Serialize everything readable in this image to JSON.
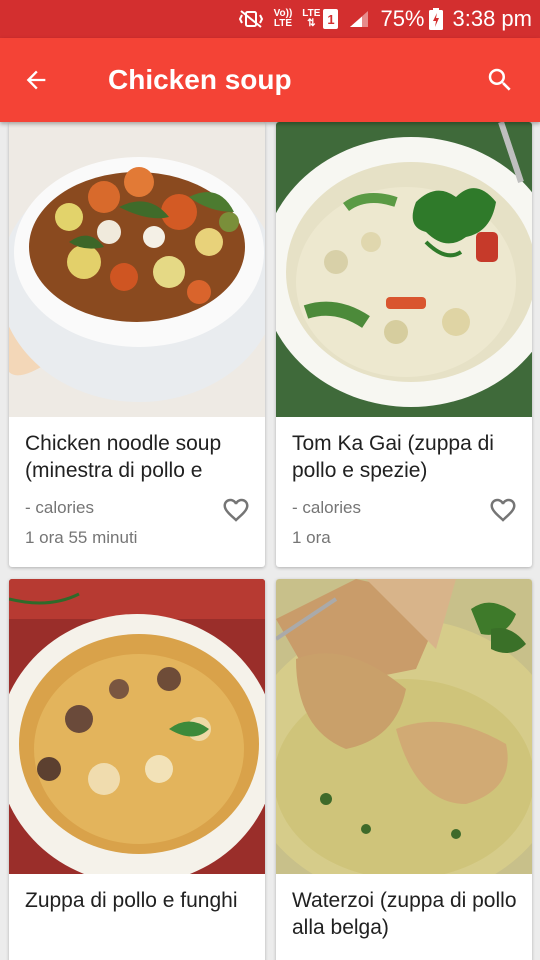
{
  "status_bar": {
    "volte_top": "Vo))",
    "volte_bottom": "LTE",
    "lte_top": "LTE",
    "lte_bottom": "⇅",
    "sim": "1",
    "battery": "75%",
    "time": "3:38 pm"
  },
  "toolbar": {
    "title": "Chicken soup",
    "back_icon": "arrow-back-icon",
    "search_icon": "search-icon"
  },
  "colors": {
    "status_bar": "#d32f2f",
    "toolbar": "#f44336",
    "background": "#ececec"
  },
  "recipes": [
    {
      "title": "Chicken noodle soup (minestra di pollo e",
      "calories": "- calories",
      "time": "1 ora 55 minuti",
      "image": "chicken-noodle-soup-photo"
    },
    {
      "title": "Tom Ka Gai (zuppa di pollo e spezie)",
      "calories": "- calories",
      "time": "1 ora",
      "image": "tom-ka-gai-photo"
    },
    {
      "title": "Zuppa di pollo e funghi",
      "calories": "",
      "time": "",
      "image": "chicken-mushroom-soup-photo"
    },
    {
      "title": "Waterzoi (zuppa di pollo alla belga)",
      "calories": "",
      "time": "",
      "image": "waterzoi-photo"
    }
  ]
}
